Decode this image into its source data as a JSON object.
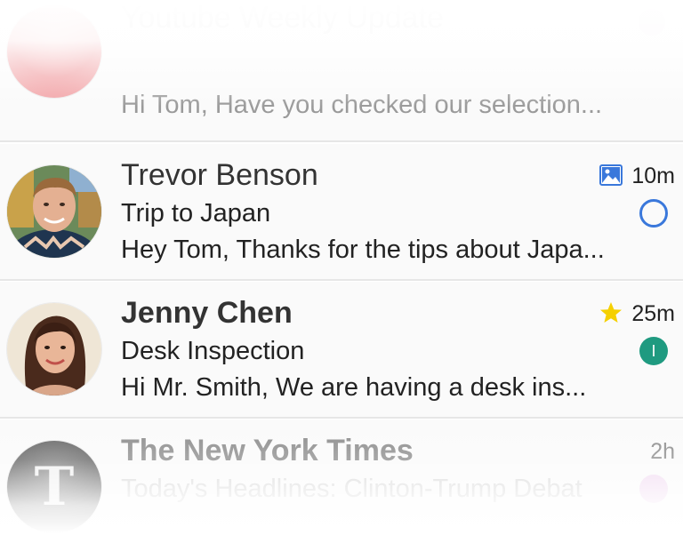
{
  "emails": [
    {
      "sender": "Youtube Weekly Update",
      "preview": "Hi Tom, Have you checked our selection...",
      "avatar_icon": "pink-avatar-icon",
      "status_color": "#f1dff1"
    },
    {
      "sender": "Trevor Benson",
      "subject": "Trip to Japan",
      "preview": "Hey Tom, Thanks for the tips about Japa...",
      "time": "10m",
      "meta_icon": "image-attachment-icon",
      "status_icon": "unread-circle-icon",
      "accent_color": "#3a78db"
    },
    {
      "sender": "Jenny Chen",
      "subject": "Desk Inspection",
      "preview": "Hi Mr. Smith, We are having a desk ins...",
      "time": "25m",
      "meta_icon": "star-icon",
      "status_label": "I",
      "status_color": "#1f9a80",
      "star_color": "#f5d000"
    },
    {
      "sender": "The New York Times",
      "subject": "Today's Headlines: Clinton-Trump Debat",
      "time": "2h",
      "avatar_icon": "nyt-logo-icon",
      "status_color": "#f0d8f0"
    }
  ]
}
